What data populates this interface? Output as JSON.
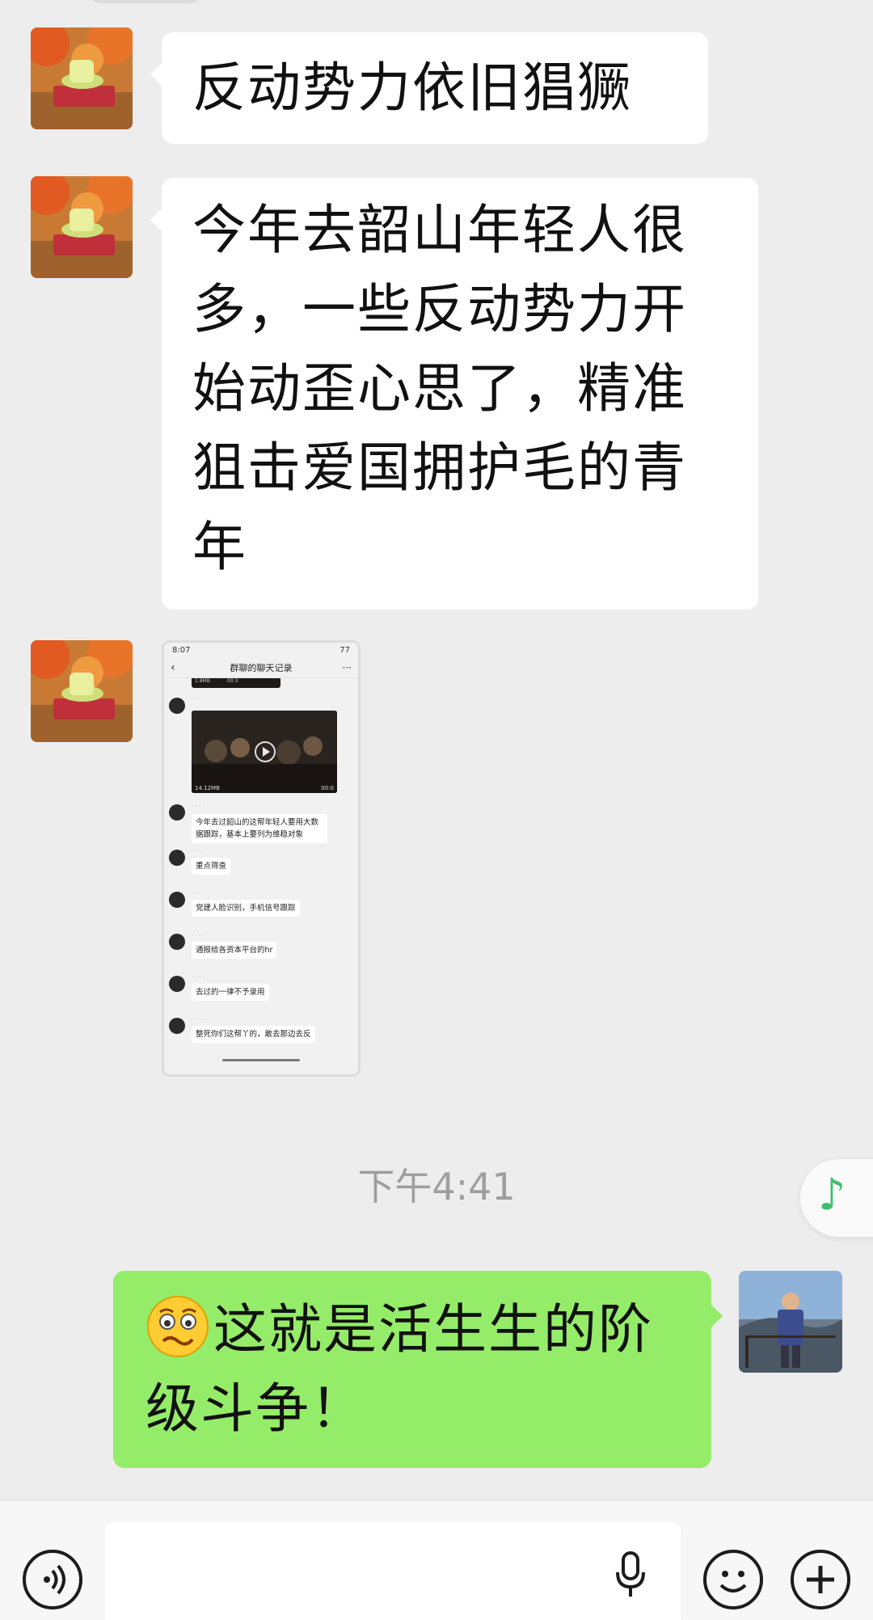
{
  "messages": [
    {
      "side": "in",
      "text": "反动势力依旧猖獗"
    },
    {
      "side": "in",
      "lines": [
        "今年去韶山年轻人很",
        "多，一些反动势力开",
        "始动歪心思了，精准",
        "狙击爱国拥护毛的青",
        "年"
      ]
    },
    {
      "side": "in",
      "type": "image"
    },
    {
      "side": "out",
      "emoji": "woozy-face",
      "lines": [
        "这就是活生生的阶",
        "级斗争！"
      ]
    }
  ],
  "screenshot": {
    "status_time": "8:07",
    "battery": "77",
    "title": "群聊的聊天记录",
    "top_video_size": "1.8MB",
    "top_video_duration": "00:3",
    "video_size": "14.12MB",
    "video_duration": "00:0",
    "items": [
      "今年去过韶山的这帮年轻人要用大数据跟踪，基本上要列为维稳对象",
      "重点筛查",
      "党建人脸识别，手机信号跟踪",
      "通报给各资本平台的hr",
      "去过的一律不予录用",
      "整死你们这帮丫的，敢去那边去反"
    ]
  },
  "timestamp": "下午4:41",
  "colors": {
    "background": "#ededed",
    "incoming": "#ffffff",
    "outgoing": "#95ec69",
    "accent": "#3cc06b"
  },
  "icons": [
    "voice-toggle-icon",
    "microphone-icon",
    "emoji-icon",
    "plus-icon",
    "music-note-icon"
  ]
}
